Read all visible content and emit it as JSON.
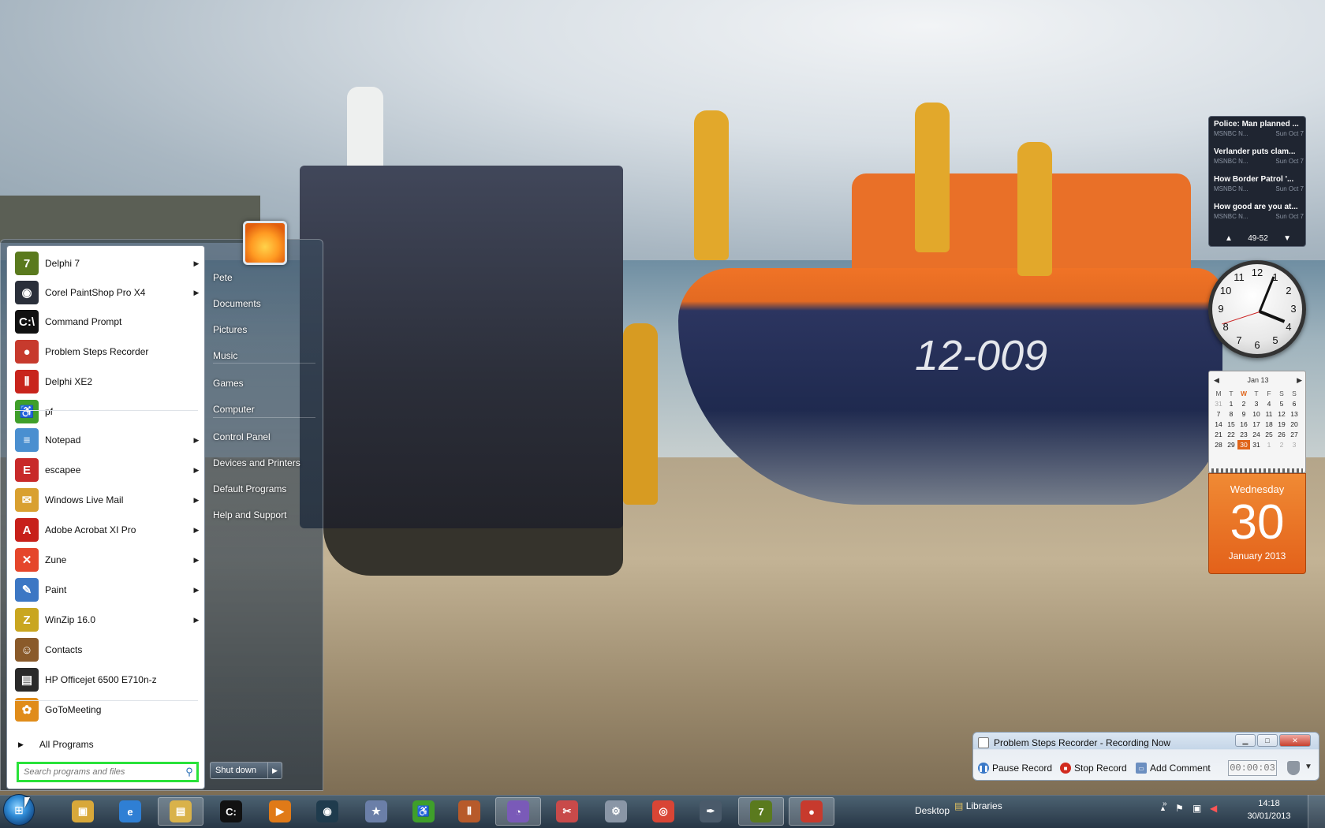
{
  "start_menu": {
    "programs": [
      {
        "label": "Delphi 7",
        "icon": "delphi7-icon",
        "color": "#5a7a1e",
        "glyph": "7",
        "arrow": true
      },
      {
        "label": "Corel PaintShop Pro X4",
        "icon": "paintshop-icon",
        "color": "#2a2f3a",
        "glyph": "◉",
        "arrow": true
      },
      {
        "label": "Command Prompt",
        "icon": "command-prompt-icon",
        "color": "#111111",
        "glyph": "C:\\",
        "arrow": false
      },
      {
        "label": "Problem Steps Recorder",
        "icon": "steps-recorder-icon",
        "color": "#c73a2d",
        "glyph": "●",
        "arrow": false
      },
      {
        "label": "Delphi XE2",
        "icon": "delphi-xe2-icon",
        "color": "#c8241c",
        "glyph": "⦀",
        "arrow": false
      },
      {
        "label": "pf",
        "icon": "pf-icon",
        "color": "#3f9f2a",
        "glyph": "♿",
        "arrow": false
      },
      {
        "label": "Notepad",
        "icon": "notepad-icon",
        "color": "#4a8fd0",
        "glyph": "≡",
        "arrow": true
      },
      {
        "label": "escapee",
        "icon": "escapee-icon",
        "color": "#c82a2a",
        "glyph": "E",
        "arrow": true
      },
      {
        "label": "Windows Live Mail",
        "icon": "mail-icon",
        "color": "#d9a030",
        "glyph": "✉",
        "arrow": true
      },
      {
        "label": "Adobe Acrobat XI Pro",
        "icon": "acrobat-icon",
        "color": "#c7201a",
        "glyph": "A",
        "arrow": true
      },
      {
        "label": "Zune",
        "icon": "zune-icon",
        "color": "#e5462b",
        "glyph": "✕",
        "arrow": true
      },
      {
        "label": "Paint",
        "icon": "paint-icon",
        "color": "#3c77c4",
        "glyph": "✎",
        "arrow": true
      },
      {
        "label": "WinZip 16.0",
        "icon": "winzip-icon",
        "color": "#c9a620",
        "glyph": "Z",
        "arrow": true
      },
      {
        "label": "Contacts",
        "icon": "contacts-icon",
        "color": "#8a5a2a",
        "glyph": "☺",
        "arrow": false
      },
      {
        "label": "HP Officejet 6500 E710n-z",
        "icon": "printer-icon",
        "color": "#2a2a2a",
        "glyph": "▤",
        "arrow": false
      },
      {
        "label": "GoToMeeting",
        "icon": "gotomeeting-icon",
        "color": "#e08c1a",
        "glyph": "✿",
        "arrow": false
      }
    ],
    "all_programs": "All Programs",
    "search_placeholder": "Search programs and files",
    "right_items": [
      {
        "label": "Pete",
        "name": "user-folder"
      },
      {
        "label": "Documents",
        "name": "documents"
      },
      {
        "label": "Pictures",
        "name": "pictures"
      },
      {
        "label": "Music",
        "name": "music"
      },
      {
        "label": "Games",
        "name": "games"
      },
      {
        "label": "Computer",
        "name": "computer"
      },
      {
        "label": "Control Panel",
        "name": "control-panel"
      },
      {
        "label": "Devices and Printers",
        "name": "devices-printers"
      },
      {
        "label": "Default Programs",
        "name": "default-programs"
      },
      {
        "label": "Help and Support",
        "name": "help-support"
      }
    ],
    "shutdown": "Shut down"
  },
  "news_gadget": {
    "items": [
      {
        "title": "Police: Man planned ...",
        "source": "MSNBC N...",
        "date": "Sun Oct 7"
      },
      {
        "title": "Verlander puts clam...",
        "source": "MSNBC N...",
        "date": "Sun Oct 7"
      },
      {
        "title": "How Border Patrol '...",
        "source": "MSNBC N...",
        "date": "Sun Oct 7"
      },
      {
        "title": "How good are you at...",
        "source": "MSNBC N...",
        "date": "Sun Oct 7"
      }
    ],
    "range": "49-52"
  },
  "clock_gadget": {
    "numbers": [
      "12",
      "1",
      "2",
      "3",
      "4",
      "5",
      "6",
      "7",
      "8",
      "9",
      "10",
      "11"
    ]
  },
  "calendar_gadget": {
    "month": "Jan 13",
    "day_headers": [
      "M",
      "T",
      "W",
      "T",
      "F",
      "S",
      "S"
    ],
    "weeks": [
      [
        "31",
        "1",
        "2",
        "3",
        "4",
        "5",
        "6"
      ],
      [
        "7",
        "8",
        "9",
        "10",
        "11",
        "12",
        "13"
      ],
      [
        "14",
        "15",
        "16",
        "17",
        "18",
        "19",
        "20"
      ],
      [
        "21",
        "22",
        "23",
        "24",
        "25",
        "26",
        "27"
      ],
      [
        "28",
        "29",
        "30",
        "31",
        "1",
        "2",
        "3"
      ]
    ],
    "weekday": "Wednesday",
    "day": "30",
    "month_year": "January 2013",
    "accent": "#e0651a"
  },
  "psr": {
    "title": "Problem Steps Recorder - Recording Now",
    "pause": "Pause Record",
    "stop": "Stop Record",
    "comment": "Add Comment",
    "timer": "00:00:03"
  },
  "taskbar": {
    "desktop_label": "Desktop",
    "libraries_label": "Libraries",
    "time": "14:18",
    "date": "30/01/2013",
    "buttons": [
      {
        "name": "explorer-folder",
        "icon": "folder-icon",
        "color": "#d8a83a",
        "glyph": "▣",
        "active": false
      },
      {
        "name": "internet-explorer",
        "icon": "ie-icon",
        "color": "#2f7fd4",
        "glyph": "e",
        "active": false
      },
      {
        "name": "windows-explorer",
        "icon": "libraries-icon",
        "color": "#d9b24a",
        "glyph": "▤",
        "active": true
      },
      {
        "name": "command-prompt",
        "icon": "command-prompt-icon",
        "color": "#111111",
        "glyph": "C:",
        "active": false
      },
      {
        "name": "media-player",
        "icon": "media-player-icon",
        "color": "#e07a18",
        "glyph": "▶",
        "active": false
      },
      {
        "name": "paintshop",
        "icon": "paintshop-icon",
        "color": "#1f3b4d",
        "glyph": "◉",
        "active": false
      },
      {
        "name": "favorites",
        "icon": "star-icon",
        "color": "#6b7fa8",
        "glyph": "★",
        "active": false
      },
      {
        "name": "pf",
        "icon": "pf-icon",
        "color": "#3f9f2a",
        "glyph": "♿",
        "active": false
      },
      {
        "name": "delphi",
        "icon": "delphi-icon",
        "color": "#b75a2a",
        "glyph": "⦀",
        "active": false
      },
      {
        "name": "clock-app",
        "icon": "clock-app-icon",
        "color": "#7a5ab8",
        "glyph": "◔",
        "active": true
      },
      {
        "name": "snipping-tool",
        "icon": "scissors-icon",
        "color": "#c84a4a",
        "glyph": "✂",
        "active": false
      },
      {
        "name": "control-panel",
        "icon": "settings-icon",
        "color": "#8a96a6",
        "glyph": "⚙",
        "active": false
      },
      {
        "name": "chrome",
        "icon": "chrome-icon",
        "color": "#d94535",
        "glyph": "◎",
        "active": false
      },
      {
        "name": "pen-app",
        "icon": "pen-icon",
        "color": "#4a5a6a",
        "glyph": "✒",
        "active": false
      },
      {
        "name": "delphi7",
        "icon": "delphi7-icon",
        "color": "#5a7a1e",
        "glyph": "7",
        "active": true
      },
      {
        "name": "steps-recorder",
        "icon": "steps-recorder-icon",
        "color": "#c73a2d",
        "glyph": "●",
        "active": true
      }
    ]
  }
}
